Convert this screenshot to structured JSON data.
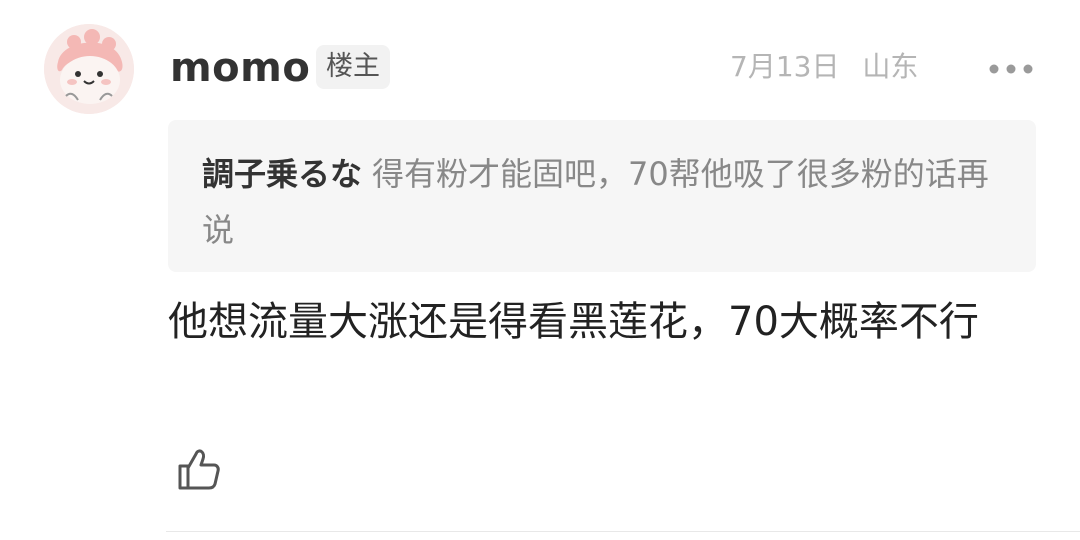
{
  "post": {
    "username": "momo",
    "badge": "楼主",
    "date": "7月13日",
    "location": "山东",
    "avatar_icon": "cartoon-avatar-icon",
    "more_icon": "more-dots-icon",
    "like_icon": "thumbs-up-icon"
  },
  "quote": {
    "author": "調子乗るな",
    "text": "得有粉才能固吧，70帮他吸了很多粉的话再说"
  },
  "comment": {
    "text": "他想流量大涨还是得看黑莲花，70大概率不行"
  },
  "colors": {
    "meta_gray": "#b5b5b5",
    "quote_bg": "#f6f6f6",
    "avatar_bg": "#f7e6e4"
  }
}
